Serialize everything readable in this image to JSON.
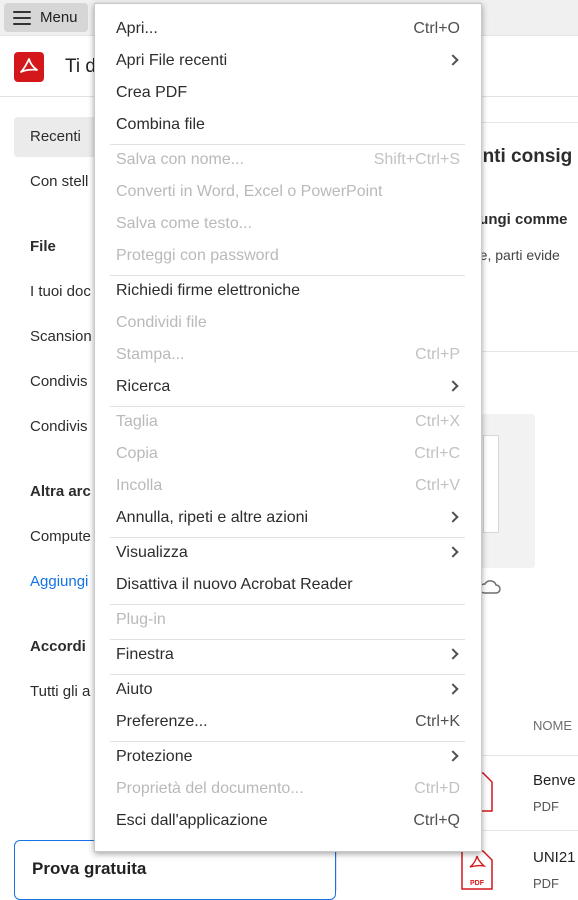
{
  "topbar": {
    "menu_label": "Menu"
  },
  "header": {
    "title": "Ti d"
  },
  "sidebar": {
    "items": [
      {
        "label": "Recenti"
      },
      {
        "label": "Con stell"
      },
      {
        "label": "File"
      },
      {
        "label": "I tuoi doc"
      },
      {
        "label": "Scansion"
      },
      {
        "label": "Condivis"
      },
      {
        "label": "Condivis"
      },
      {
        "label": "Altra arc"
      },
      {
        "label": "Compute"
      },
      {
        "label": "Aggiungi"
      },
      {
        "label": "Accordi"
      },
      {
        "label": "Tutti gli a"
      }
    ]
  },
  "right_panel": {
    "title": "enti consig",
    "subtitle": "iungi comme",
    "desc": "ote, parti evide",
    "column_header": "NOME",
    "files": [
      {
        "name": "Benve",
        "type": "PDF"
      },
      {
        "name": "UNI21",
        "type": "PDF"
      }
    ]
  },
  "trial": {
    "label": "Prova gratuita"
  },
  "menu": {
    "items": [
      {
        "label": "Apri...",
        "shortcut": "Ctrl+O",
        "enabled": true,
        "submenu": false
      },
      {
        "label": "Apri File recenti",
        "shortcut": "",
        "enabled": true,
        "submenu": true
      },
      {
        "label": "Crea PDF",
        "shortcut": "",
        "enabled": true,
        "submenu": false
      },
      {
        "label": "Combina file",
        "shortcut": "",
        "enabled": true,
        "submenu": false
      },
      {
        "label": "Salva con nome...",
        "shortcut": "Shift+Ctrl+S",
        "enabled": false,
        "submenu": false
      },
      {
        "label": "Converti in Word, Excel o PowerPoint",
        "shortcut": "",
        "enabled": false,
        "submenu": false
      },
      {
        "label": "Salva come testo...",
        "shortcut": "",
        "enabled": false,
        "submenu": false
      },
      {
        "label": "Proteggi con password",
        "shortcut": "",
        "enabled": false,
        "submenu": false
      },
      {
        "label": "Richiedi firme elettroniche",
        "shortcut": "",
        "enabled": true,
        "submenu": false
      },
      {
        "label": "Condividi file",
        "shortcut": "",
        "enabled": false,
        "submenu": false
      },
      {
        "label": "Stampa...",
        "shortcut": "Ctrl+P",
        "enabled": false,
        "submenu": false
      },
      {
        "label": "Ricerca",
        "shortcut": "",
        "enabled": true,
        "submenu": true
      },
      {
        "label": "Taglia",
        "shortcut": "Ctrl+X",
        "enabled": false,
        "submenu": false
      },
      {
        "label": "Copia",
        "shortcut": "Ctrl+C",
        "enabled": false,
        "submenu": false
      },
      {
        "label": "Incolla",
        "shortcut": "Ctrl+V",
        "enabled": false,
        "submenu": false
      },
      {
        "label": "Annulla, ripeti e altre azioni",
        "shortcut": "",
        "enabled": true,
        "submenu": true
      },
      {
        "label": "Visualizza",
        "shortcut": "",
        "enabled": true,
        "submenu": true
      },
      {
        "label": "Disattiva il nuovo Acrobat Reader",
        "shortcut": "",
        "enabled": true,
        "submenu": false
      },
      {
        "label": "Plug-in",
        "shortcut": "",
        "enabled": false,
        "submenu": false
      },
      {
        "label": "Finestra",
        "shortcut": "",
        "enabled": true,
        "submenu": true
      },
      {
        "label": "Aiuto",
        "shortcut": "",
        "enabled": true,
        "submenu": true
      },
      {
        "label": "Preferenze...",
        "shortcut": "Ctrl+K",
        "enabled": true,
        "submenu": false
      },
      {
        "label": "Protezione",
        "shortcut": "",
        "enabled": true,
        "submenu": true
      },
      {
        "label": "Proprietà del documento...",
        "shortcut": "Ctrl+D",
        "enabled": false,
        "submenu": false
      },
      {
        "label": "Esci dall'applicazione",
        "shortcut": "Ctrl+Q",
        "enabled": true,
        "submenu": false
      }
    ]
  },
  "colors": {
    "brand": "#d3171b",
    "accent": "#1473e6",
    "disabled_text": "#b9b9b9"
  }
}
